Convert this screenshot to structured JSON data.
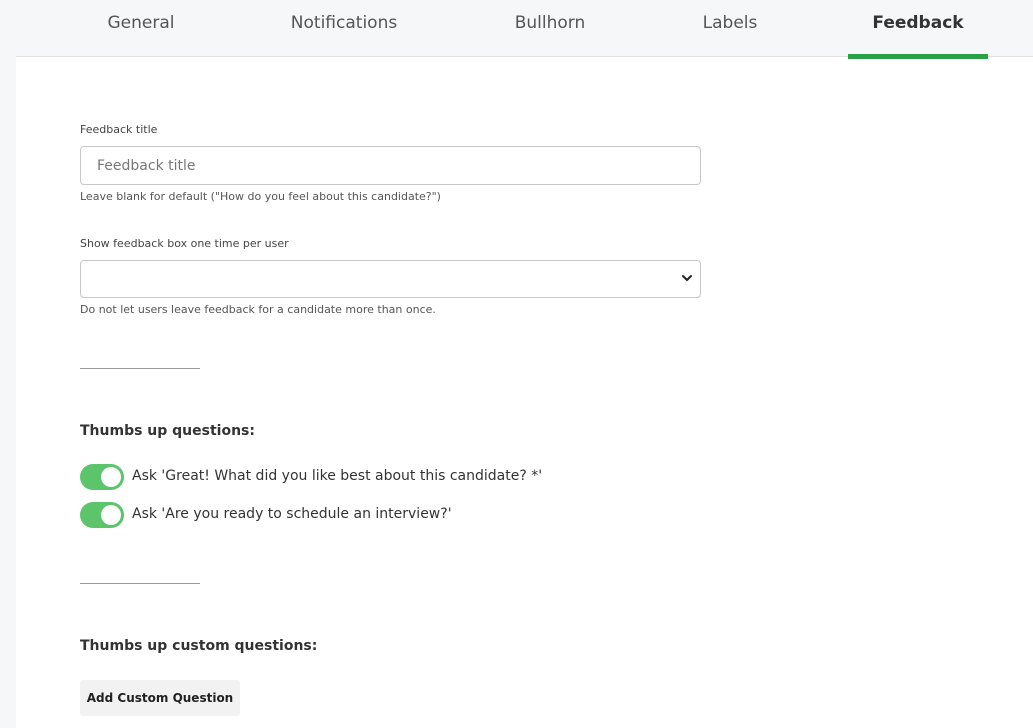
{
  "tabs": [
    {
      "label": "General",
      "active": false
    },
    {
      "label": "Notifications",
      "active": false
    },
    {
      "label": "Bullhorn",
      "active": false
    },
    {
      "label": "Labels",
      "active": false
    },
    {
      "label": "Feedback",
      "active": true
    }
  ],
  "colors": {
    "accent": "#2aa146",
    "toggle_on": "#5cc46a"
  },
  "feedback_title": {
    "label": "Feedback title",
    "placeholder": "Feedback title",
    "value": "",
    "help": "Leave blank for default (\"How do you feel about this candidate?\")"
  },
  "show_once": {
    "label": "Show feedback box one time per user",
    "selected": "",
    "help": "Do not let users leave feedback for a candidate more than once."
  },
  "thumbs_up": {
    "title": "Thumbs up questions:",
    "questions": [
      {
        "label": "Ask 'Great! What did you like best about this candidate? *'",
        "enabled": true
      },
      {
        "label": "Ask 'Are you ready to schedule an interview?'",
        "enabled": true
      }
    ]
  },
  "custom": {
    "title": "Thumbs up custom questions:",
    "add_button": "Add Custom Question"
  },
  "icons": {
    "select_arrow": "chevron-down-icon"
  }
}
